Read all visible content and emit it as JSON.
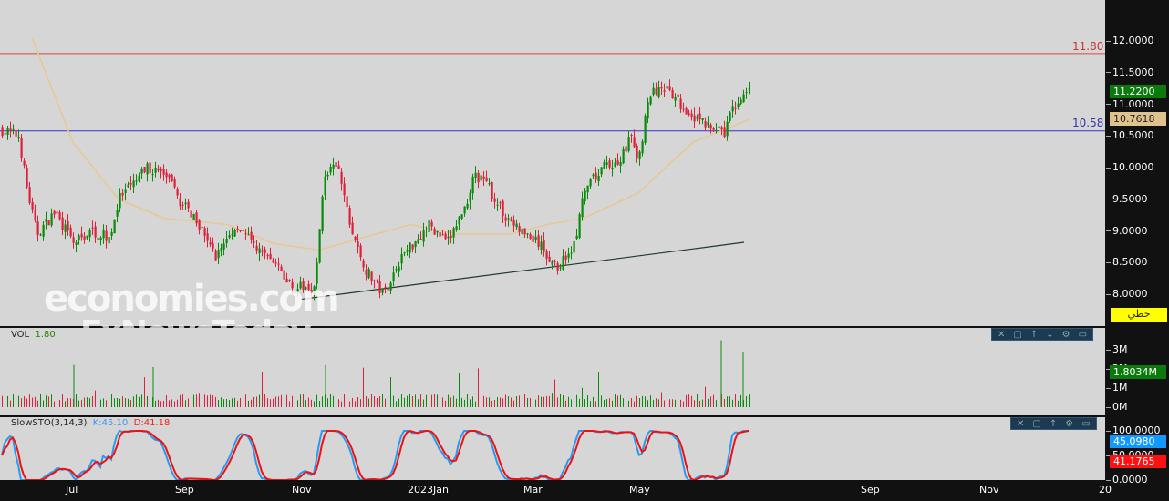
{
  "watermark": {
    "line1": "economies.com",
    "line2": "FxNewsToday"
  },
  "price_scale": {
    "ticks": [
      "12.0000",
      "11.5000",
      "11.0000",
      "10.5000",
      "10.0000",
      "9.5000",
      "9.0000",
      "8.5000",
      "8.0000"
    ],
    "last_price": "11.2200",
    "ma_value": "10.7618",
    "mode_label": "خطي"
  },
  "hlines": [
    {
      "label": "11.80",
      "value": 11.8,
      "color": "#d44"
    },
    {
      "label": "10.58",
      "value": 10.58,
      "color": "#33c"
    }
  ],
  "volume": {
    "label": "VOL",
    "value": "1.80",
    "ticks": [
      "3M",
      "2M",
      "1M",
      "0M"
    ],
    "last": "1.8034M"
  },
  "stoch": {
    "label": "SlowSTO(3,14,3)",
    "k_label": "K:45.10",
    "d_label": "D:41.18",
    "ticks": [
      "100.0000",
      "50.0000",
      "0.0000"
    ],
    "k_last": "45.0980",
    "d_last": "41.1765"
  },
  "time_axis": [
    {
      "label": "Jul",
      "x": 72
    },
    {
      "label": "Sep",
      "x": 192
    },
    {
      "label": "Nov",
      "x": 320
    },
    {
      "label": "2023Jan",
      "x": 447
    },
    {
      "label": "Mar",
      "x": 574
    },
    {
      "label": "May",
      "x": 690
    },
    {
      "label": "Sep",
      "x": 944
    },
    {
      "label": "Nov",
      "x": 1074
    },
    {
      "label": "20",
      "x": 1205
    }
  ],
  "toolbar_icons": [
    "close-icon",
    "maximize-icon",
    "move-up-icon",
    "move-down-icon",
    "settings-icon",
    "more-icon"
  ],
  "chart_data": {
    "type": "candlestick",
    "price_path": [
      [
        0,
        10.6
      ],
      [
        20,
        10.5
      ],
      [
        30,
        9.6
      ],
      [
        40,
        8.95
      ],
      [
        60,
        9.3
      ],
      [
        80,
        8.8
      ],
      [
        100,
        9.0
      ],
      [
        120,
        8.9
      ],
      [
        130,
        9.5
      ],
      [
        150,
        9.8
      ],
      [
        160,
        10.0
      ],
      [
        180,
        9.9
      ],
      [
        200,
        9.4
      ],
      [
        215,
        9.2
      ],
      [
        235,
        8.6
      ],
      [
        260,
        9.1
      ],
      [
        275,
        8.8
      ],
      [
        300,
        8.5
      ],
      [
        320,
        8.1
      ],
      [
        345,
        8.1
      ],
      [
        355,
        9.9
      ],
      [
        370,
        10.0
      ],
      [
        385,
        9.0
      ],
      [
        400,
        8.4
      ],
      [
        420,
        8.0
      ],
      [
        440,
        8.6
      ],
      [
        470,
        9.1
      ],
      [
        490,
        8.8
      ],
      [
        510,
        9.4
      ],
      [
        520,
        9.9
      ],
      [
        535,
        9.7
      ],
      [
        550,
        9.3
      ],
      [
        570,
        9.0
      ],
      [
        590,
        8.8
      ],
      [
        610,
        8.4
      ],
      [
        630,
        8.8
      ],
      [
        640,
        9.6
      ],
      [
        660,
        10.0
      ],
      [
        680,
        10.1
      ],
      [
        690,
        10.5
      ],
      [
        700,
        10.1
      ],
      [
        710,
        11.1
      ],
      [
        725,
        11.3
      ],
      [
        745,
        11.0
      ],
      [
        770,
        10.7
      ],
      [
        785,
        10.6
      ],
      [
        795,
        10.5
      ],
      [
        800,
        10.9
      ],
      [
        810,
        11.0
      ],
      [
        822,
        11.22
      ]
    ],
    "ma_path": [
      [
        35,
        12.05
      ],
      [
        80,
        10.4
      ],
      [
        130,
        9.5
      ],
      [
        180,
        9.2
      ],
      [
        250,
        9.1
      ],
      [
        300,
        8.8
      ],
      [
        350,
        8.7
      ],
      [
        400,
        8.9
      ],
      [
        450,
        9.1
      ],
      [
        500,
        8.95
      ],
      [
        560,
        8.95
      ],
      [
        600,
        9.1
      ],
      [
        640,
        9.2
      ],
      [
        700,
        9.6
      ],
      [
        760,
        10.4
      ],
      [
        822,
        10.76
      ]
    ],
    "trendline": [
      [
        330,
        7.92
      ],
      [
        816,
        8.82
      ]
    ],
    "ylim": [
      7.5,
      12.6
    ]
  }
}
